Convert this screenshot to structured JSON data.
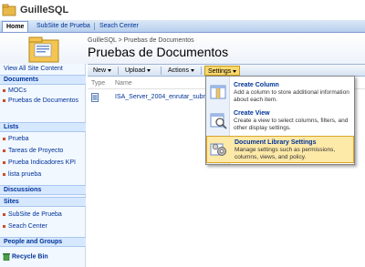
{
  "site": {
    "title": "GuilleSQL"
  },
  "tabs": [
    {
      "label": "Home",
      "active": true
    },
    {
      "label": "SubSite de Prueba",
      "active": false
    },
    {
      "label": "Seach Center",
      "active": false
    }
  ],
  "header": {
    "breadcrumb": "GuilleSQL > Pruebas de Documentos",
    "title": "Pruebas de Documentos"
  },
  "toolbar": {
    "new": "New",
    "upload": "Upload",
    "actions": "Actions",
    "settings": "Settings"
  },
  "list": {
    "col_type": "Type",
    "col_name": "Name",
    "rows": [
      {
        "name": "ISA_Server_2004_enrutar_subr"
      }
    ]
  },
  "leftnav": {
    "view_all": "View All Site Content",
    "sections": [
      {
        "title": "Documents",
        "items": [
          "MOCs",
          "Pruebas de Documentos"
        ]
      },
      {
        "title": "Lists",
        "items": [
          "Prueba",
          "Tareas de Proyecto",
          "Prueba Indicadores KPI",
          "lista prueba"
        ]
      },
      {
        "title": "Discussions",
        "items": []
      },
      {
        "title": "Sites",
        "items": [
          "SubSite de Prueba",
          "Seach Center"
        ]
      },
      {
        "title": "People and Groups",
        "items": []
      }
    ],
    "recycle_bin": "Recycle Bin"
  },
  "settings_menu": [
    {
      "title": "Create Column",
      "desc": "Add a column to store additional information about each item.",
      "icon": "create-column-icon"
    },
    {
      "title": "Create View",
      "desc": "Create a view to select columns, filters, and other display settings.",
      "icon": "create-view-icon"
    },
    {
      "title": "Document Library Settings",
      "desc": "Manage settings such as permissions, columns, views, and policy.",
      "icon": "library-settings-icon"
    }
  ],
  "colors": {
    "link": "#003399",
    "highlight": "#fde9a8",
    "nav_bg": "#f2f8ff"
  }
}
